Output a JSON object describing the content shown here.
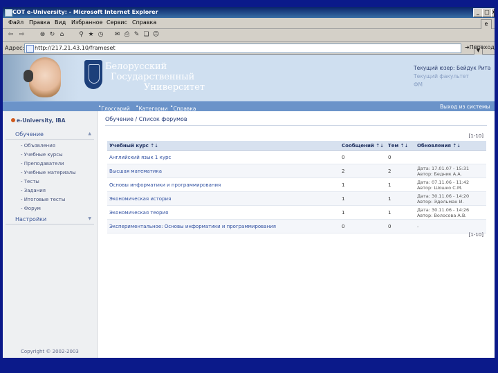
{
  "window": {
    "title": "СОТ e-University: - Microsoft Internet Explorer",
    "controls": [
      "_",
      "□",
      "×"
    ]
  },
  "menubar": {
    "items": [
      "Файл",
      "Правка",
      "Вид",
      "Избранное",
      "Сервис",
      "Справка"
    ]
  },
  "address": {
    "label": "Адрес:",
    "url": "http://217.21.43.10/frameset",
    "go_label": "Переход"
  },
  "header": {
    "university_lines": [
      "Белорусский",
      "Государственный",
      "Университет"
    ],
    "current_user": "Текущий юзер: Бейдук Рита",
    "faculty_label": "Текущий факультет",
    "faculty_value": "ФМ"
  },
  "nav": {
    "items": [
      "Глоссарий",
      "Категории",
      "Справка"
    ],
    "logout": "Выход из системы"
  },
  "sidebar": {
    "brand": "e-University, IBA",
    "sections": [
      {
        "title": "Обучение",
        "items": [
          "Объявления",
          "Учебные курсы",
          "Преподаватели",
          "Учебные материалы",
          "Тесты",
          "Задания",
          "Итоговые тесты",
          "Форум"
        ]
      },
      {
        "title": "Настройки",
        "items": []
      }
    ],
    "copyright": "Copyright © 2002-2003"
  },
  "main": {
    "breadcrumb": "Обучение / Список форумов",
    "pager_top": "[1-10]",
    "pager_bottom": "[1-10]",
    "table": {
      "headers": [
        "Учебный курс ⇡⇣",
        "Сообщений ⇡⇣",
        "Тем ⇡⇣",
        "Обновления ⇡⇣"
      ],
      "rows": [
        {
          "course": "Английский язык 1 курс",
          "messages": "0",
          "topics": "0",
          "update": [
            "",
            ""
          ]
        },
        {
          "course": "Высшая математика",
          "messages": "2",
          "topics": "2",
          "update": [
            "Дата: 17.01.07 - 15:31",
            "Автор: Бедник А.А."
          ]
        },
        {
          "course": "Основы информатики и программирования",
          "messages": "1",
          "topics": "1",
          "update": [
            "Дата: 07.11.06 - 11:42",
            "Автор: Шошко С.М."
          ]
        },
        {
          "course": "Экономическая история",
          "messages": "1",
          "topics": "1",
          "update": [
            "Дата: 30.11.06 - 14:20",
            "Автор: Эдельман И."
          ]
        },
        {
          "course": "Экономическая теория",
          "messages": "1",
          "topics": "1",
          "update": [
            "Дата: 30.11.06 - 14:26",
            "Автор: Волосова А.В."
          ]
        },
        {
          "course": "Экспериментальное: Основы информатики и программирования",
          "messages": "0",
          "topics": "0",
          "update": [
            "-",
            ""
          ]
        }
      ]
    }
  },
  "colors": {
    "frame": "#0b1a8a",
    "nav": "#6b93c9",
    "header_bg": "#cfdff0",
    "link": "#2f4fa0"
  }
}
